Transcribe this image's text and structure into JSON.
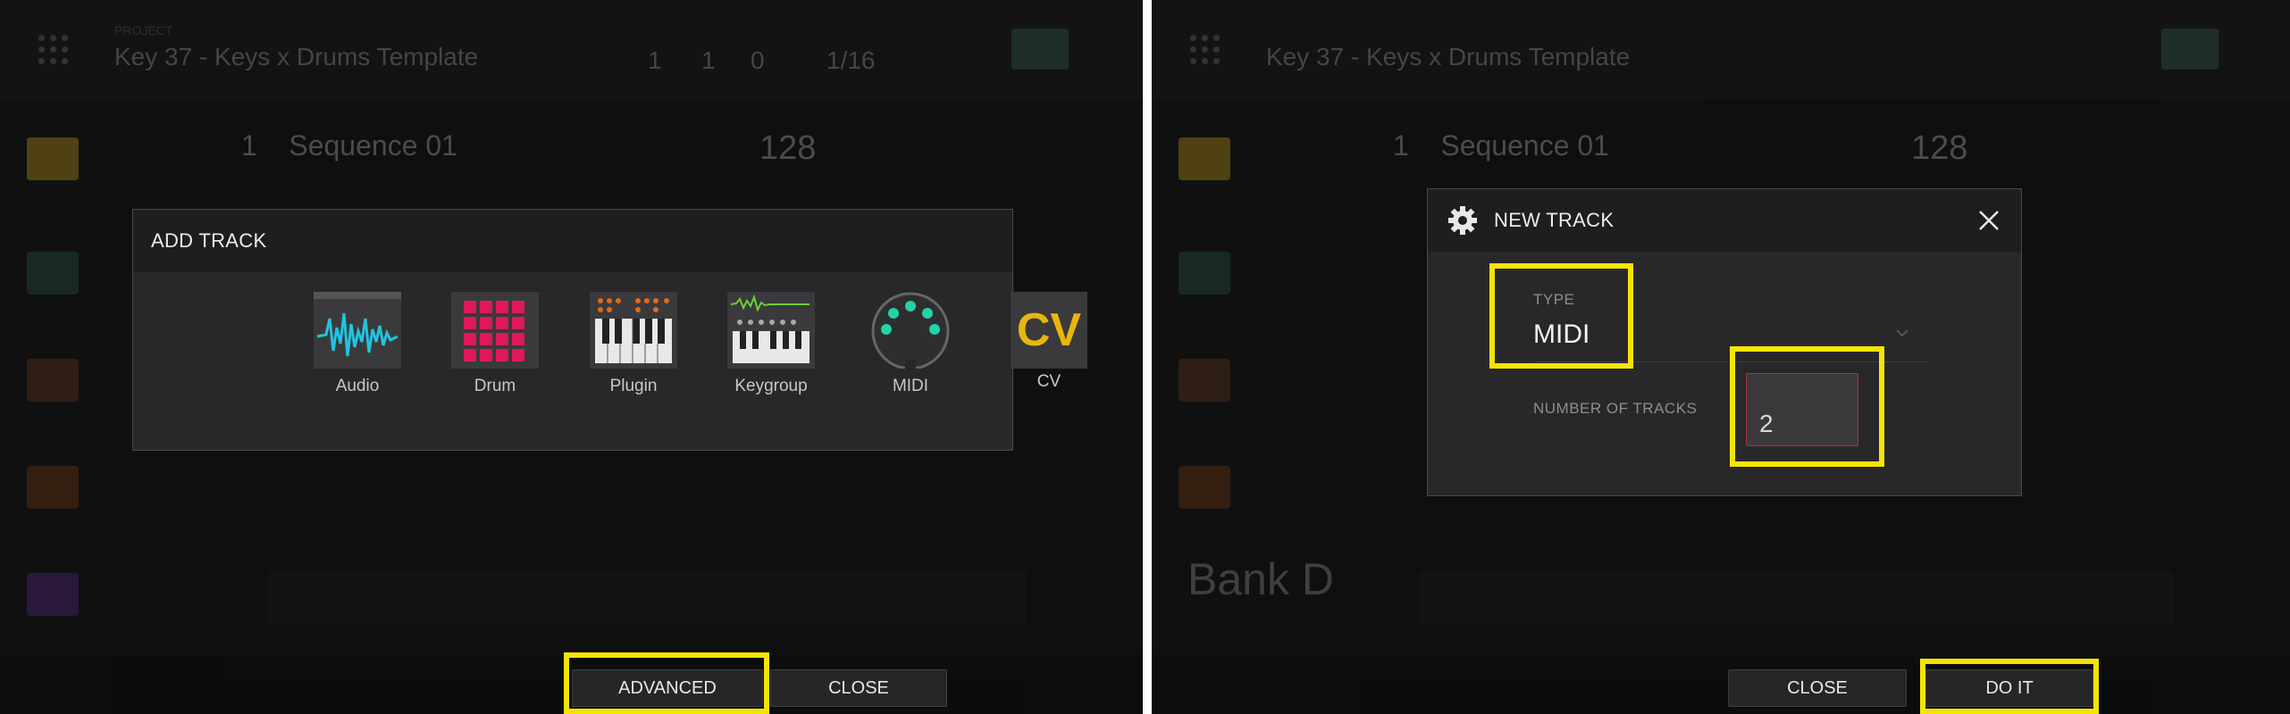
{
  "left_screen": {
    "background": {
      "project_title": "Key 37 - Keys x Drums Template",
      "project_label": "PROJECT",
      "counters": [
        "1",
        "1",
        "0",
        "1/16"
      ],
      "sequence_number": "1",
      "sequence_name": "Sequence 01",
      "bpm": "128"
    },
    "dialog": {
      "title": "ADD TRACK",
      "track_types": [
        {
          "label": "Audio",
          "icon": "audio-waveform-icon"
        },
        {
          "label": "Drum",
          "icon": "drum-pads-icon"
        },
        {
          "label": "Plugin",
          "icon": "plugin-keyboard-icon"
        },
        {
          "label": "Keygroup",
          "icon": "keygroup-icon"
        },
        {
          "label": "MIDI",
          "icon": "midi-port-icon"
        },
        {
          "label": "CV",
          "icon": "cv-icon"
        }
      ],
      "cv_glyph": "CV"
    },
    "buttons": {
      "advanced": "ADVANCED",
      "close": "CLOSE"
    }
  },
  "right_screen": {
    "background": {
      "project_title": "Key 37 - Keys x Drums Template",
      "sequence_number": "1",
      "sequence_name": "Sequence 01",
      "bpm": "128",
      "bank": "Bank D"
    },
    "dialog": {
      "title": "NEW TRACK",
      "type_label": "TYPE",
      "type_value": "MIDI",
      "num_tracks_label": "NUMBER OF TRACKS",
      "num_tracks_value": "2"
    },
    "buttons": {
      "close": "CLOSE",
      "do_it": "DO IT"
    }
  },
  "colors": {
    "highlight": "#f4e500",
    "drum_pad": "#e0185a",
    "audio_wave": "#22c4e0",
    "cv": "#e8b60e",
    "midi_dot": "#22d3a8"
  }
}
